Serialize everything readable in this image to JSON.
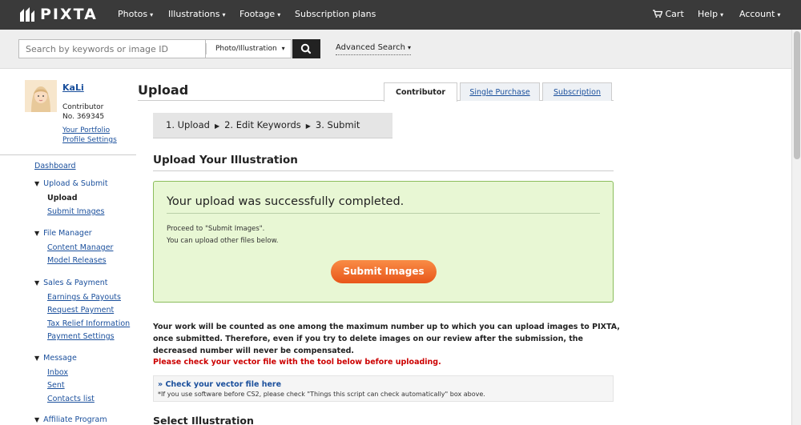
{
  "nav": {
    "logo": "PIXTA",
    "items": [
      {
        "label": "Photos",
        "caret": "▾"
      },
      {
        "label": "Illustrations",
        "caret": "▾"
      },
      {
        "label": "Footage",
        "caret": "▾"
      },
      {
        "label": "Subscription plans",
        "caret": ""
      }
    ],
    "cart": "Cart",
    "help": "Help",
    "account": "Account"
  },
  "search": {
    "placeholder": "Search by keywords or image ID",
    "type": "Photo/Illustration",
    "advanced": "Advanced Search"
  },
  "user": {
    "name": "KaLi",
    "role": "Contributor",
    "number": "No. 369345",
    "portfolio": "Your Portfolio",
    "profile": "Profile Settings"
  },
  "sidebar": {
    "dashboard": "Dashboard",
    "upload_group": "Upload & Submit",
    "upload": "Upload",
    "submit_images": "Submit Images",
    "file_group": "File Manager",
    "content_manager": "Content Manager",
    "model_releases": "Model Releases",
    "sales_group": "Sales & Payment",
    "earnings": "Earnings & Payouts",
    "request_payment": "Request Payment",
    "tax_relief": "Tax Relief Information",
    "payment_settings": "Payment Settings",
    "message_group": "Message",
    "inbox": "Inbox",
    "sent": "Sent",
    "contacts": "Contacts list",
    "affiliate_group": "Affiliate Program"
  },
  "main": {
    "title": "Upload",
    "tabs": [
      {
        "label": "Contributor"
      },
      {
        "label": "Single Purchase"
      },
      {
        "label": "Subscription"
      }
    ],
    "steps": [
      "1. Upload",
      "2. Edit Keywords",
      "3. Submit"
    ],
    "section_title": "Upload Your Illustration",
    "success": {
      "title": "Your upload was successfully completed.",
      "line1": "Proceed to \"Submit Images\".",
      "line2": "You can upload other files below.",
      "button": "Submit Images"
    },
    "warning": [
      "Your work will be counted as one among the maximum number up to which you can upload images to PIXTA,",
      "once submitted. Therefore, even if you try to delete images on our review after the submission, the",
      "decreased number will never be compensated."
    ],
    "warning_red": "Please check your vector file with the tool below before uploading.",
    "check": {
      "link": "» Check your vector file here",
      "note": "*If you use software before CS2, please check \"Things this script can check automatically\" box above."
    },
    "select_title": "Select Illustration"
  }
}
